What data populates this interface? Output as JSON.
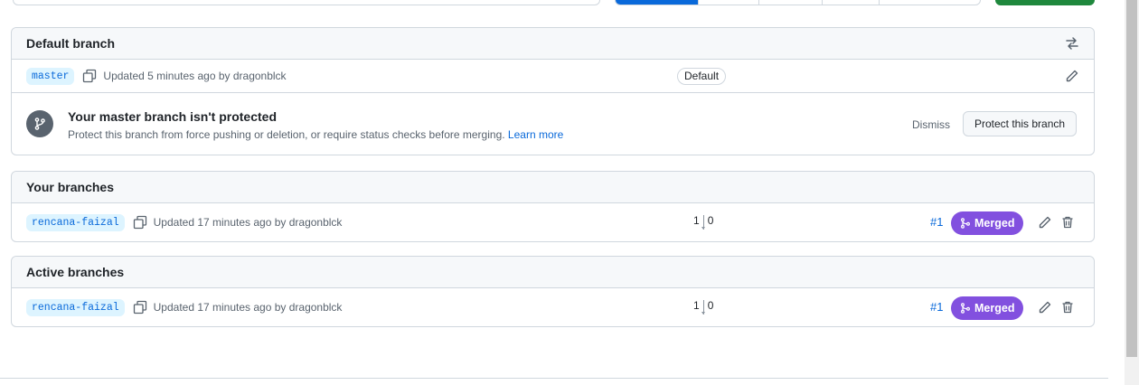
{
  "default_branch": {
    "header": "Default branch",
    "branch": "master",
    "meta": "Updated 5 minutes ago by dragonblck",
    "badge": "Default",
    "notice": {
      "title": "Your master branch isn't protected",
      "desc": "Protect this branch from force pushing or deletion, or require status checks before merging.",
      "learn_more": "Learn more",
      "dismiss": "Dismiss",
      "protect_button": "Protect this branch"
    }
  },
  "your_branches": {
    "header": "Your branches",
    "rows": [
      {
        "branch": "rencana-faizal",
        "meta": "Updated 17 minutes ago by dragonblck",
        "behind": "1",
        "ahead": "0",
        "pr": "#1",
        "status": "Merged"
      }
    ]
  },
  "active_branches": {
    "header": "Active branches",
    "rows": [
      {
        "branch": "rencana-faizal",
        "meta": "Updated 17 minutes ago by dragonblck",
        "behind": "1",
        "ahead": "0",
        "pr": "#1",
        "status": "Merged"
      }
    ]
  },
  "colors": {
    "accent": "#0969da",
    "merged": "#8250df",
    "success": "#1f883d",
    "border": "#d0d7de",
    "muted": "#59636e"
  },
  "icons": [
    "switch-arrows-icon",
    "copy-icon",
    "pencil-icon",
    "git-branch-icon",
    "git-merge-icon",
    "trash-icon"
  ]
}
